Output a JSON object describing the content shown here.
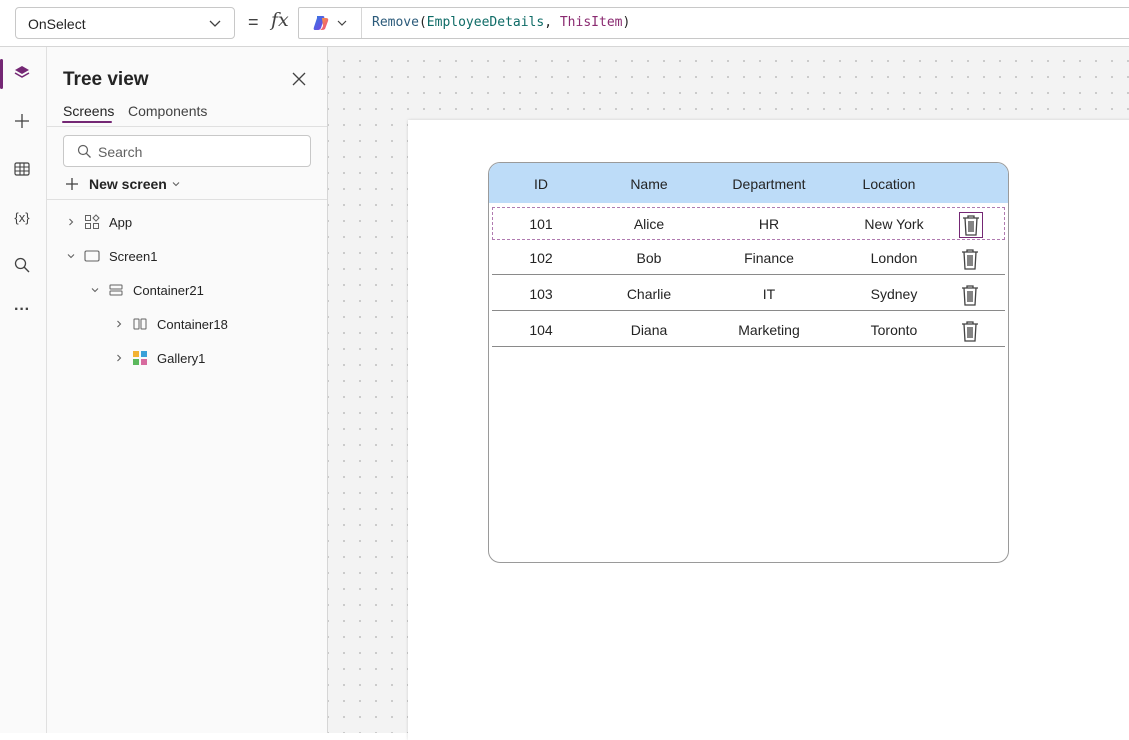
{
  "formula_bar": {
    "property": "OnSelect",
    "equals": "=",
    "fx": "fx",
    "formula": {
      "fn": "Remove",
      "open": "(",
      "arg1": "EmployeeDetails",
      "sep": ", ",
      "arg2": "ThisItem",
      "close": ")"
    }
  },
  "rail": {
    "items": [
      "tree-view-icon",
      "insert-icon",
      "data-icon",
      "variables-icon",
      "search-icon",
      "more-icon"
    ],
    "variables_glyph": "{x}",
    "more_glyph": "···"
  },
  "tree_view": {
    "title": "Tree view",
    "tabs": [
      {
        "label": "Screens",
        "active": true
      },
      {
        "label": "Components",
        "active": false
      }
    ],
    "search_placeholder": "Search",
    "new_screen_label": "New screen",
    "nodes": [
      {
        "label": "App"
      },
      {
        "label": "Screen1"
      },
      {
        "label": "Container21"
      },
      {
        "label": "Container18"
      },
      {
        "label": "Gallery1"
      }
    ]
  },
  "gallery": {
    "headers": [
      "ID",
      "Name",
      "Department",
      "Location"
    ],
    "rows": [
      {
        "id": "101",
        "name": "Alice",
        "department": "HR",
        "location": "New York",
        "selected": true
      },
      {
        "id": "102",
        "name": "Bob",
        "department": "Finance",
        "location": "London",
        "selected": false
      },
      {
        "id": "103",
        "name": "Charlie",
        "department": "IT",
        "location": "Sydney",
        "selected": false
      },
      {
        "id": "104",
        "name": "Diana",
        "department": "Marketing",
        "location": "Toronto",
        "selected": false
      }
    ]
  },
  "colors": {
    "accent": "#742774",
    "header_fill": "#bddcf8",
    "canvas_bg": "#f3f3f3"
  }
}
